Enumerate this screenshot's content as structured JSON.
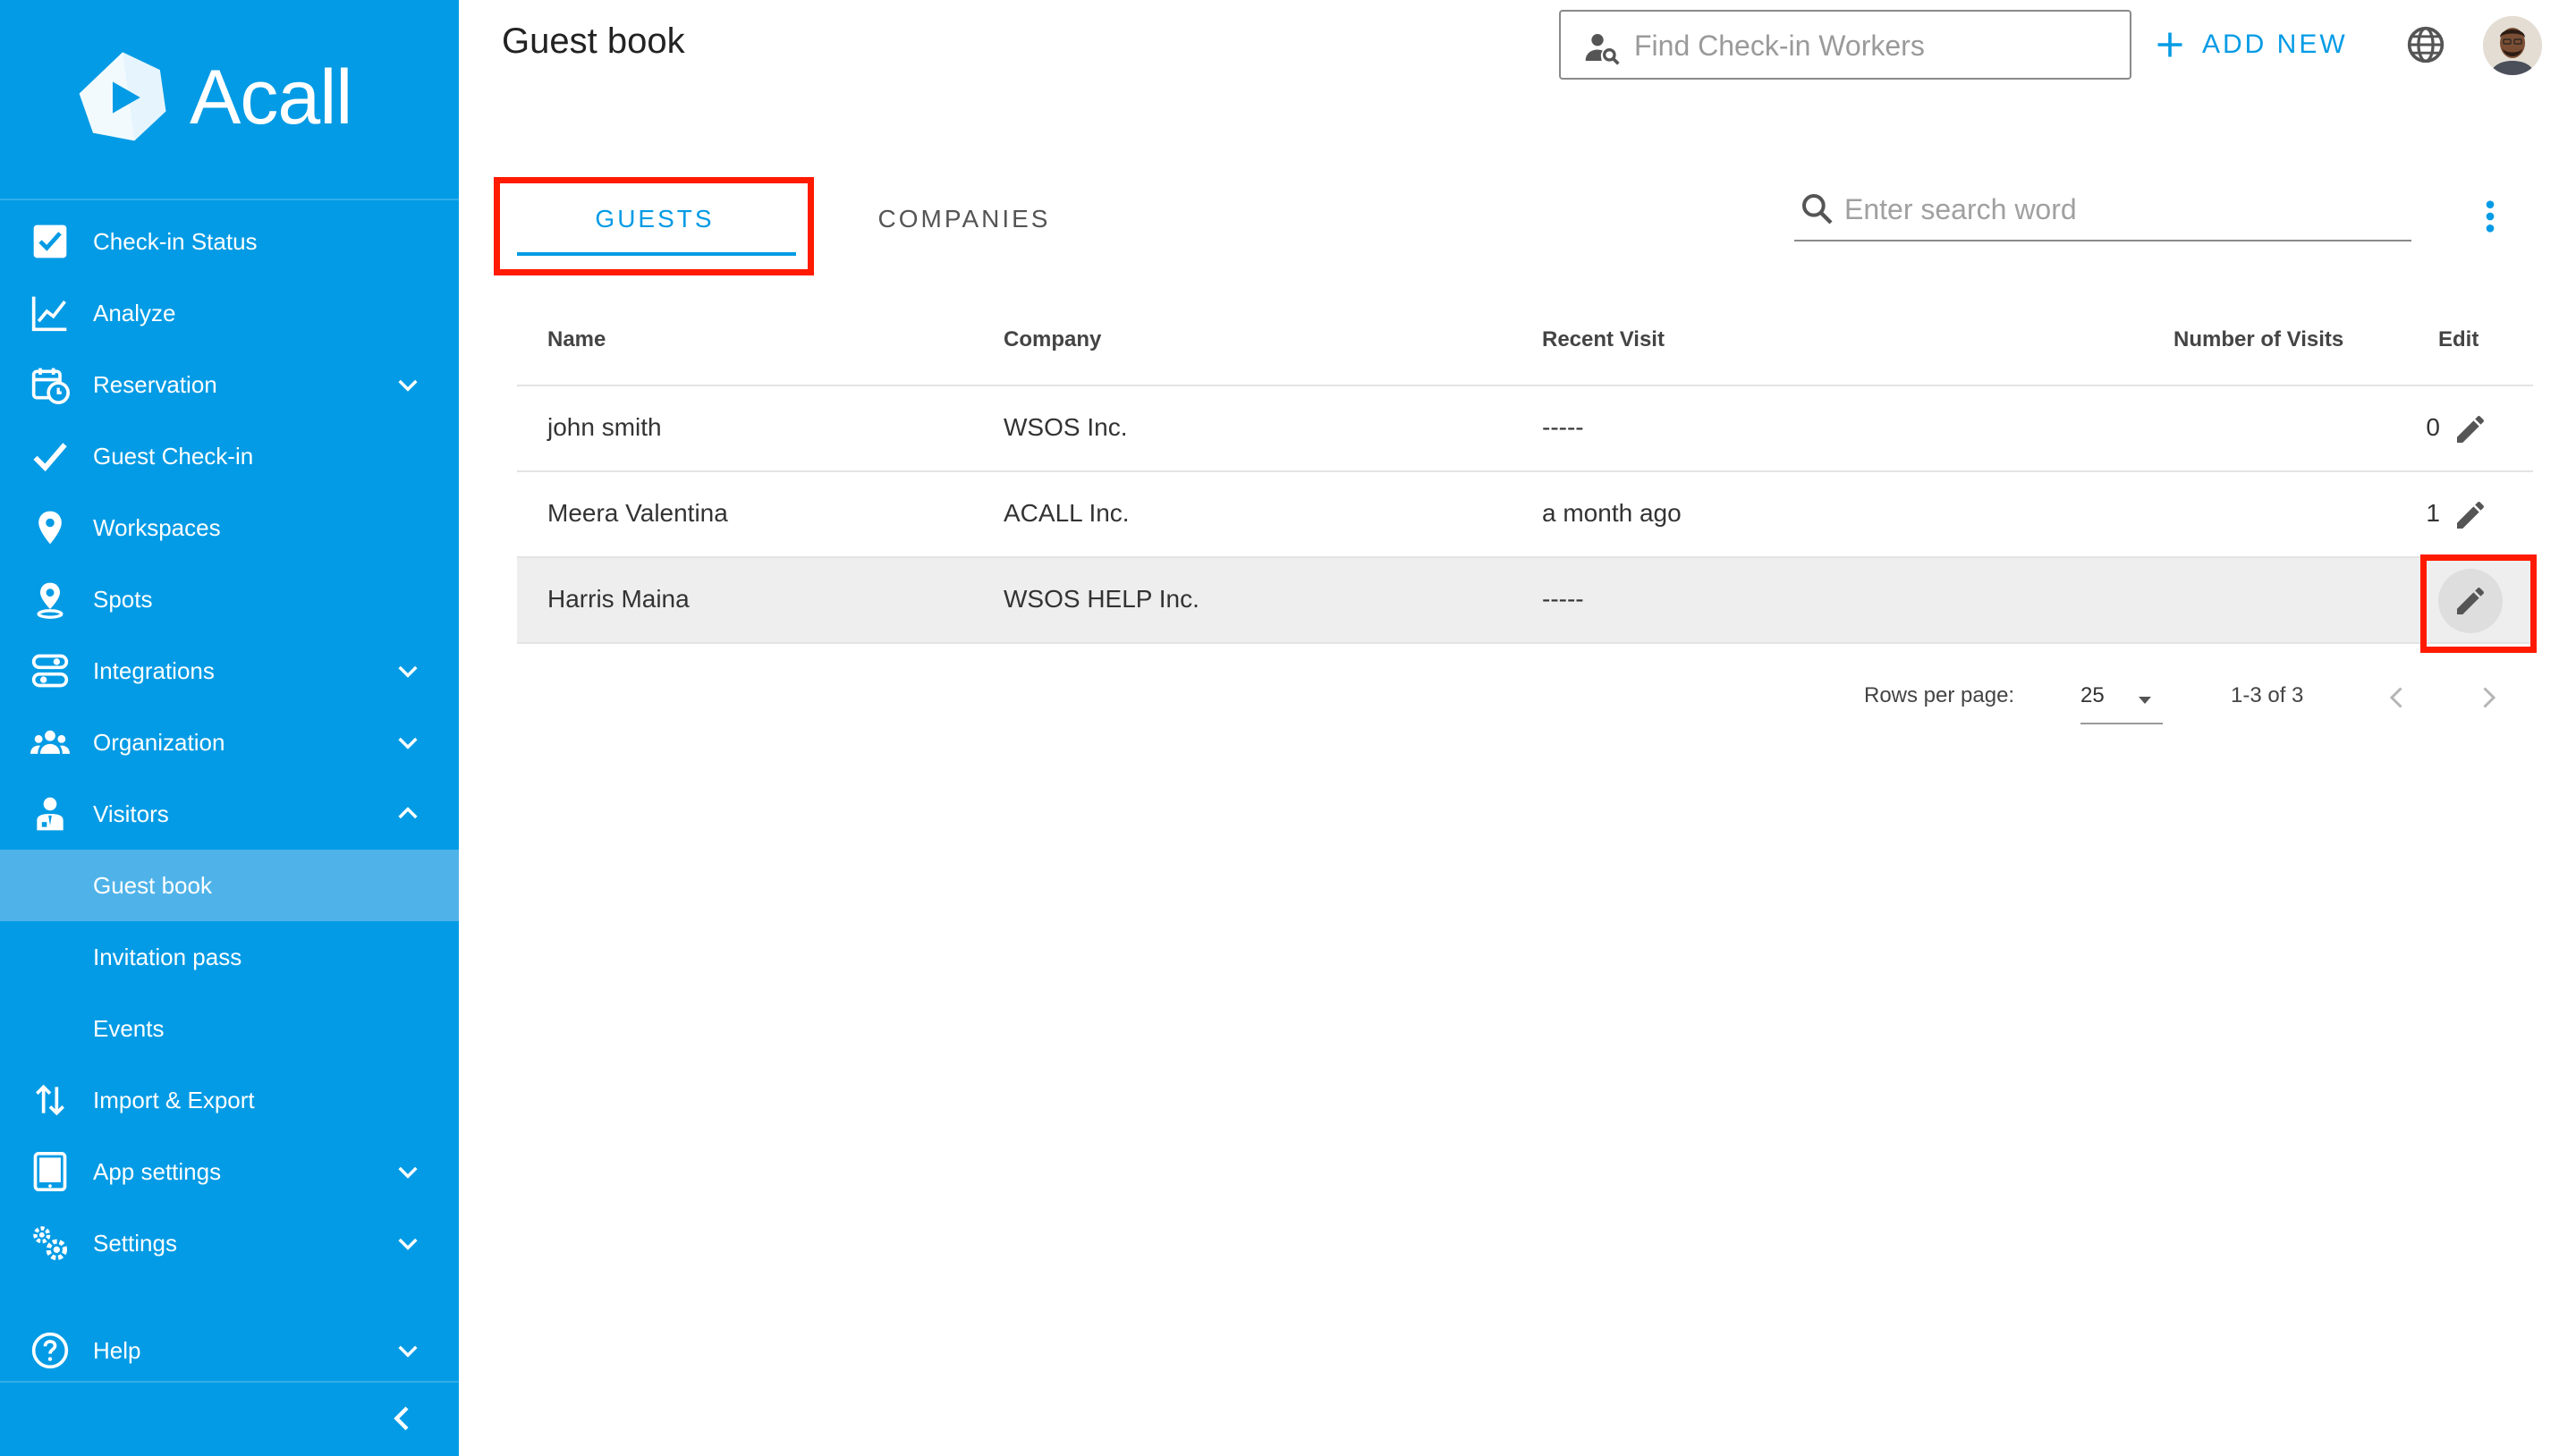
{
  "app": {
    "brand": "Acall",
    "accent": "#039be5",
    "sidebar_bg": "#039be5"
  },
  "sidebar": {
    "items": [
      {
        "label": "Check-in Status",
        "icon": "checkbox-icon"
      },
      {
        "label": "Analyze",
        "icon": "chart-line-icon"
      },
      {
        "label": "Reservation",
        "icon": "calendar-clock-icon",
        "expandable": true
      },
      {
        "label": "Guest Check-in",
        "icon": "checkmark-icon"
      },
      {
        "label": "Workspaces",
        "icon": "location-pin-icon"
      },
      {
        "label": "Spots",
        "icon": "person-pin-icon"
      },
      {
        "label": "Integrations",
        "icon": "integrations-icon",
        "expandable": true
      },
      {
        "label": "Organization",
        "icon": "people-group-icon",
        "expandable": true
      },
      {
        "label": "Visitors",
        "icon": "visitor-icon",
        "expandable": true,
        "expanded": true
      },
      {
        "label": "Guest book",
        "sub": true,
        "active": true
      },
      {
        "label": "Invitation pass",
        "sub": true
      },
      {
        "label": "Events",
        "sub": true
      },
      {
        "label": "Import & Export",
        "icon": "import-export-icon"
      },
      {
        "label": "App settings",
        "icon": "tablet-icon",
        "expandable": true
      },
      {
        "label": "Settings",
        "icon": "gears-icon",
        "expandable": true
      },
      {
        "label": "Help",
        "icon": "help-circle-icon",
        "expandable": true
      }
    ]
  },
  "header": {
    "title": "Guest book",
    "worker_search_placeholder": "Find Check-in Workers",
    "add_new": "ADD NEW"
  },
  "tabs": [
    {
      "label": "GUESTS",
      "selected": true
    },
    {
      "label": "COMPANIES",
      "selected": false
    }
  ],
  "search": {
    "placeholder": "Enter search word"
  },
  "table": {
    "columns": [
      "Name",
      "Company",
      "Recent Visit",
      "Number of Visits",
      "Edit"
    ],
    "rows": [
      {
        "name": "john smith",
        "company": "WSOS Inc.",
        "recent": "-----",
        "visits": "0"
      },
      {
        "name": "Meera Valentina",
        "company": "ACALL Inc.",
        "recent": "a month ago",
        "visits": "1"
      },
      {
        "name": "Harris Maina",
        "company": "WSOS HELP Inc.",
        "recent": "-----",
        "visits": ""
      }
    ]
  },
  "pagination": {
    "rows_per_page_label": "Rows per page:",
    "rows_per_page": "25",
    "range": "1-3 of 3"
  }
}
